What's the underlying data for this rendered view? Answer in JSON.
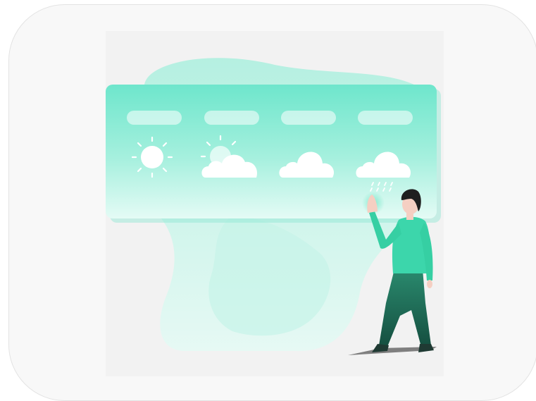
{
  "illustration": {
    "subject": "weather-forecast",
    "colors": {
      "panel_top": "#6ee6cc",
      "panel_bottom": "#dffaf3",
      "blob": "#b9f1e3",
      "blob_light": "#dcf7f0",
      "shirt": "#3cd6ab",
      "pants": "#1b6a55",
      "hair": "#1f1f1f",
      "skin": "#f5cfc2",
      "shoes": "#1f3a33",
      "shadow": "#6b6b6b",
      "frame_bg": "#f8f8f8",
      "inner_bg": "#f1f1f1"
    },
    "forecast_cards": [
      {
        "icon": "sun-icon"
      },
      {
        "icon": "partly-cloudy-icon"
      },
      {
        "icon": "cloud-icon"
      },
      {
        "icon": "rain-icon"
      }
    ]
  }
}
